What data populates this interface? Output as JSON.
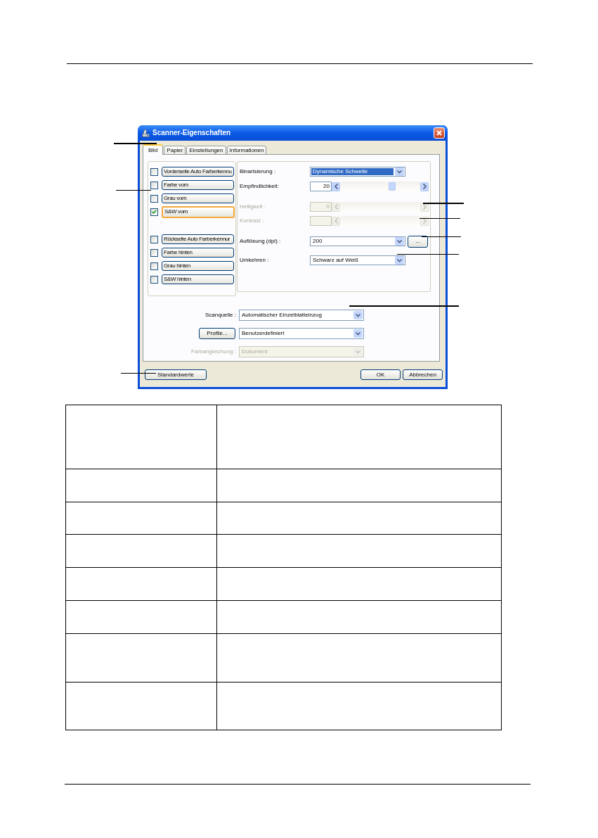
{
  "window": {
    "title": "Scanner-Eigenschaften"
  },
  "tabs": [
    {
      "label": "Bild",
      "selected": true
    },
    {
      "label": "Papier",
      "selected": false
    },
    {
      "label": "Einstellungen",
      "selected": false
    },
    {
      "label": "Informationen",
      "selected": false
    }
  ],
  "front_side": [
    {
      "label": "Vorderseite Auto Farberkennu",
      "checked": false,
      "selected": false
    },
    {
      "label": "Farbe vorn",
      "checked": false,
      "selected": false
    },
    {
      "label": "Grau vorn",
      "checked": false,
      "selected": false
    },
    {
      "label": "S&W vorn",
      "checked": true,
      "selected": true
    }
  ],
  "back_side": [
    {
      "label": "Rückseite Auto Farberkennur",
      "checked": false,
      "selected": false
    },
    {
      "label": "Farbe hinten",
      "checked": false,
      "selected": false
    },
    {
      "label": "Grau hinten",
      "checked": false,
      "selected": false
    },
    {
      "label": "S&W hinten",
      "checked": false,
      "selected": false
    }
  ],
  "settings": [
    {
      "kind": "select",
      "label": "Binarisierung :",
      "value": "Dynamische Schwelle",
      "highlighted": true,
      "disabled": false
    },
    {
      "kind": "slider",
      "label": "Empfindlichkeit:",
      "value": "20",
      "level": 0.66,
      "disabled": false
    },
    {
      "kind": "slider",
      "label": "Helligkeit :",
      "value": "0",
      "disabled": true
    },
    {
      "kind": "slider",
      "label": "Kontrast :",
      "disabled": true
    },
    {
      "kind": "select",
      "label": "Auflösung (dpi) :",
      "value": "200",
      "highlighted": false,
      "disabled": false,
      "button": "..."
    },
    {
      "kind": "select",
      "label": "Umkehren :",
      "value": "Schwarz auf Weiß",
      "highlighted": false,
      "disabled": false
    }
  ],
  "source_rows": [
    {
      "kind": "select",
      "label": "Scanquelle :",
      "value": "Automatischer Einzelblatteinzug",
      "disabled": false
    },
    {
      "kind": "button",
      "button": "Profile...",
      "value": "Benutzerdefiniert",
      "disabled": false
    },
    {
      "kind": "select",
      "label": "Farbangleichung :",
      "value": "Dokument",
      "disabled": true
    }
  ],
  "footer": {
    "left_buttons": [
      "Standardwerte"
    ],
    "right_buttons": [
      "OK",
      "Abbrechen"
    ]
  }
}
